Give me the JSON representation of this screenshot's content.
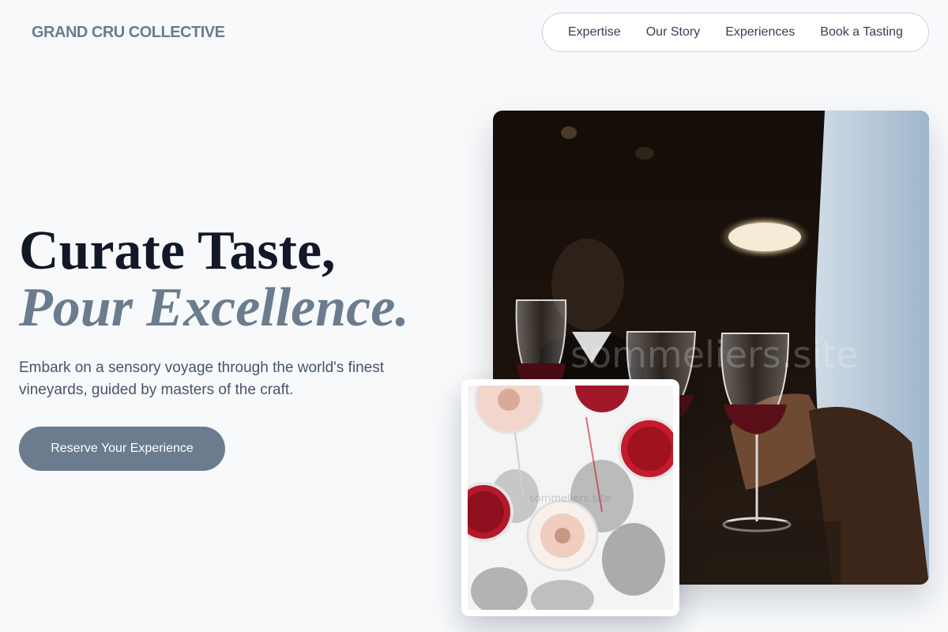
{
  "header": {
    "brand": "GRAND CRU COLLECTIVE",
    "nav": [
      {
        "label": "Expertise"
      },
      {
        "label": "Our Story"
      },
      {
        "label": "Experiences"
      },
      {
        "label": "Book a Tasting"
      }
    ]
  },
  "hero": {
    "headline_line1": "Curate Taste,",
    "headline_line2": "Pour Excellence.",
    "subtitle": "Embark on a sensory voyage through the world's finest vineyards, guided by masters of the craft.",
    "cta_label": "Reserve Your Experience"
  },
  "images": {
    "main_photo": {
      "subject": "people toasting red wine glasses",
      "watermark": "sommeliers.site"
    },
    "inset_photo": {
      "subject": "overhead view of red and rosé wine glasses",
      "watermark": "sommeliers.site"
    }
  },
  "colors": {
    "accent": "#6b7c8f",
    "background": "#f7f9fb",
    "headline": "#111827"
  }
}
